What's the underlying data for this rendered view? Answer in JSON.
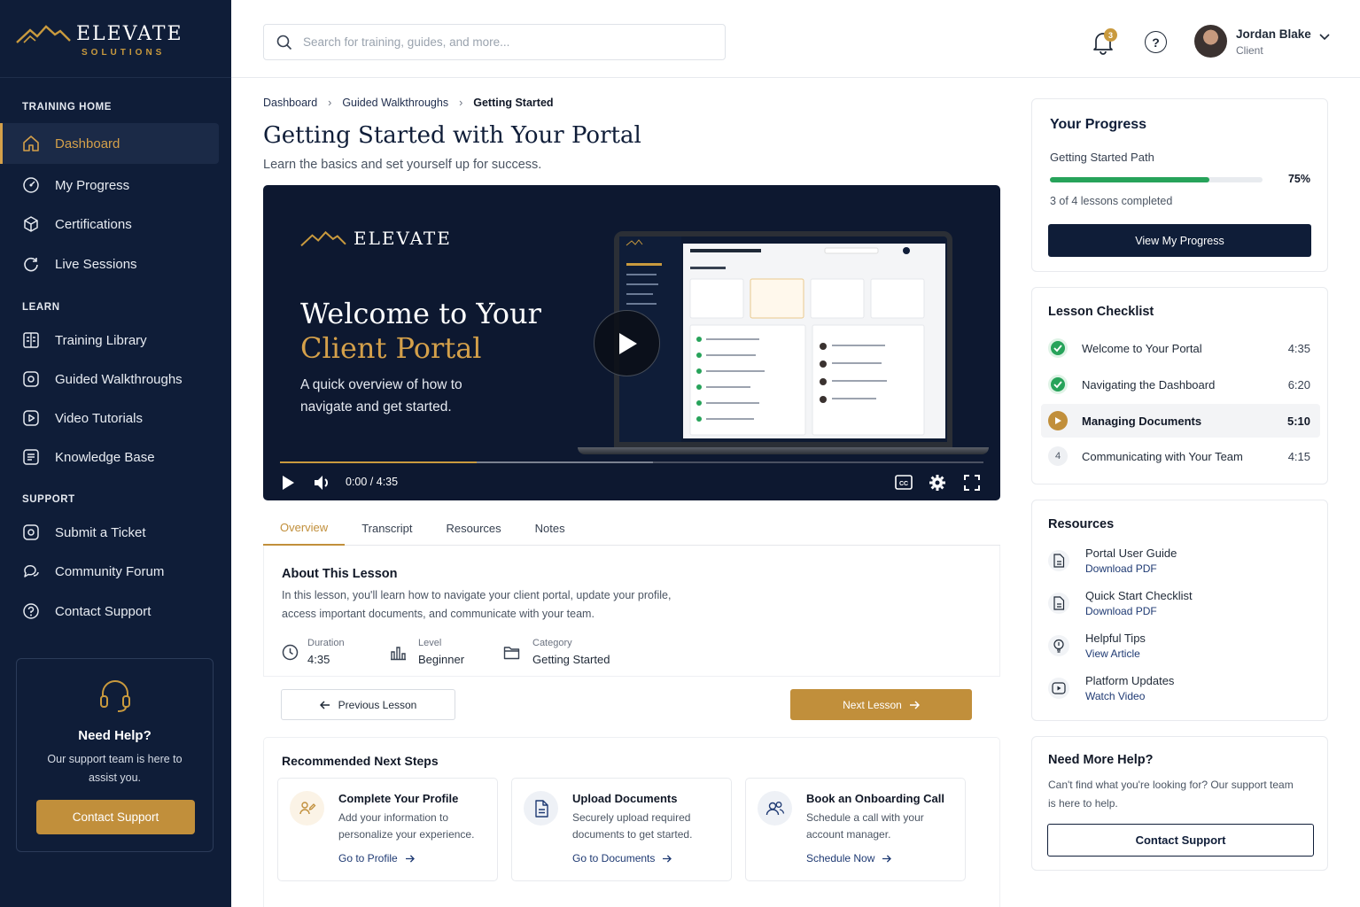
{
  "brand": {
    "name": "ELEVATE",
    "sub": "SOLUTIONS",
    "accent": "#c99a3e",
    "navy": "#0f1d38"
  },
  "sidebar": {
    "sections": [
      {
        "title": "TRAINING HOME",
        "items": [
          {
            "label": "Dashboard",
            "icon": "home-icon",
            "active": true
          },
          {
            "label": "My Progress",
            "icon": "gauge-icon"
          },
          {
            "label": "Certifications",
            "icon": "cube-icon"
          },
          {
            "label": "Live Sessions",
            "icon": "refresh-icon"
          }
        ]
      },
      {
        "title": "LEARN",
        "items": [
          {
            "label": "Training Library",
            "icon": "library-icon"
          },
          {
            "label": "Guided Walkthroughs",
            "icon": "compass-icon"
          },
          {
            "label": "Video Tutorials",
            "icon": "play-square-icon"
          },
          {
            "label": "Knowledge Base",
            "icon": "book-icon"
          }
        ]
      },
      {
        "title": "SUPPORT",
        "items": [
          {
            "label": "Submit a Ticket",
            "icon": "ticket-icon"
          },
          {
            "label": "Community Forum",
            "icon": "chat-icon"
          },
          {
            "label": "Contact Support",
            "icon": "help-circle-icon"
          }
        ]
      }
    ],
    "help": {
      "title": "Need Help?",
      "text": "Our support team is here to assist you.",
      "button": "Contact Support"
    }
  },
  "topbar": {
    "search_placeholder": "Search for training, guides, and more...",
    "notifications": "3",
    "user": {
      "name": "Jordan Blake",
      "role": "Client"
    }
  },
  "breadcrumb": [
    "Dashboard",
    "Guided Walkthroughs",
    "Getting Started"
  ],
  "page": {
    "title": "Getting Started with Your Portal",
    "subtitle": "Learn the basics and set yourself up for success."
  },
  "video": {
    "brand": "ELEVATE",
    "heading_line1": "Welcome to Your",
    "heading_line2": "Client Portal",
    "description": "A quick overview of how to navigate and get started.",
    "time": "0:00 / 4:35",
    "played_fraction": 0.28,
    "buffered_fraction": 0.53
  },
  "tabs": [
    "Overview",
    "Transcript",
    "Resources",
    "Notes"
  ],
  "about": {
    "title": "About This Lesson",
    "text": "In this lesson, you'll learn how to navigate your client portal, update your profile, access important documents, and communicate with your team.",
    "meta": [
      {
        "label": "Duration",
        "value": "4:35"
      },
      {
        "label": "Level",
        "value": "Beginner"
      },
      {
        "label": "Category",
        "value": "Getting Started"
      }
    ]
  },
  "nav_buttons": {
    "prev": "Previous Lesson",
    "next": "Next Lesson"
  },
  "recommended": {
    "title": "Recommended Next Steps",
    "cards": [
      {
        "title": "Complete Your Profile",
        "desc": "Add your information to personalize your experience.",
        "link": "Go to Profile"
      },
      {
        "title": "Upload Documents",
        "desc": "Securely upload required documents to get started.",
        "link": "Go to Documents"
      },
      {
        "title": "Book an Onboarding Call",
        "desc": "Schedule a call with your account manager.",
        "link": "Schedule Now"
      }
    ]
  },
  "progress": {
    "title": "Your Progress",
    "path": "Getting Started Path",
    "percent": 75,
    "percent_label": "75%",
    "count": "3 of 4 lessons completed",
    "button": "View My Progress"
  },
  "checklist": {
    "title": "Lesson Checklist",
    "items": [
      {
        "name": "Welcome to Your Portal",
        "duration": "4:35",
        "status": "done"
      },
      {
        "name": "Navigating the Dashboard",
        "duration": "6:20",
        "status": "done"
      },
      {
        "name": "Managing Documents",
        "duration": "5:10",
        "status": "current"
      },
      {
        "name": "Communicating with Your Team",
        "duration": "4:15",
        "status": "pending",
        "number": "4"
      }
    ]
  },
  "resources": {
    "title": "Resources",
    "items": [
      {
        "title": "Portal User Guide",
        "sub": "Download PDF"
      },
      {
        "title": "Quick Start Checklist",
        "sub": "Download PDF"
      },
      {
        "title": "Helpful Tips",
        "sub": "View Article"
      },
      {
        "title": "Platform Updates",
        "sub": "Watch Video"
      }
    ]
  },
  "more_help": {
    "title": "Need More Help?",
    "text": "Can't find what you're looking for? Our support team is here to help.",
    "button": "Contact Support"
  }
}
